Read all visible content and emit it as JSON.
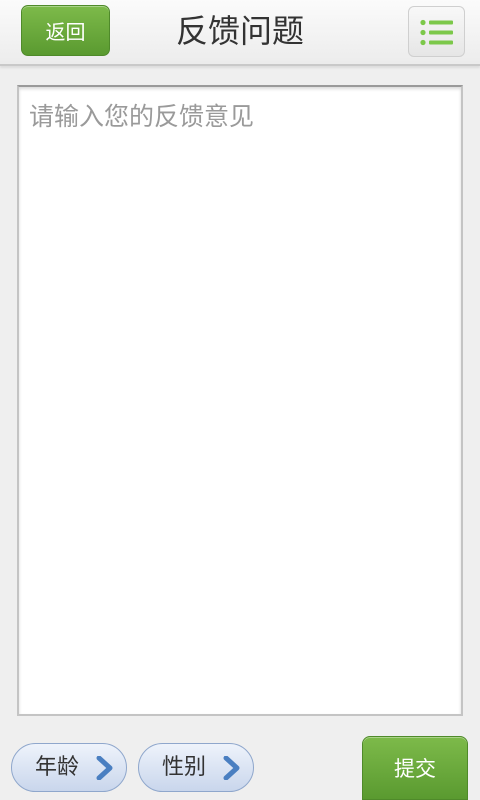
{
  "header": {
    "back_label": "返回",
    "title": "反馈问题",
    "menu_icon": "list-menu-icon"
  },
  "feedback": {
    "placeholder": "请输入您的反馈意见",
    "value": ""
  },
  "footer": {
    "age_label": "年龄",
    "gender_label": "性别",
    "chevron_icon": "chevron-right-icon",
    "submit_label": "提交"
  },
  "colors": {
    "accent_green": "#6aaa3a",
    "menu_green": "#7cc84a",
    "pill_blue": "#c9d6ec",
    "chevron_blue": "#4a7fc1"
  }
}
